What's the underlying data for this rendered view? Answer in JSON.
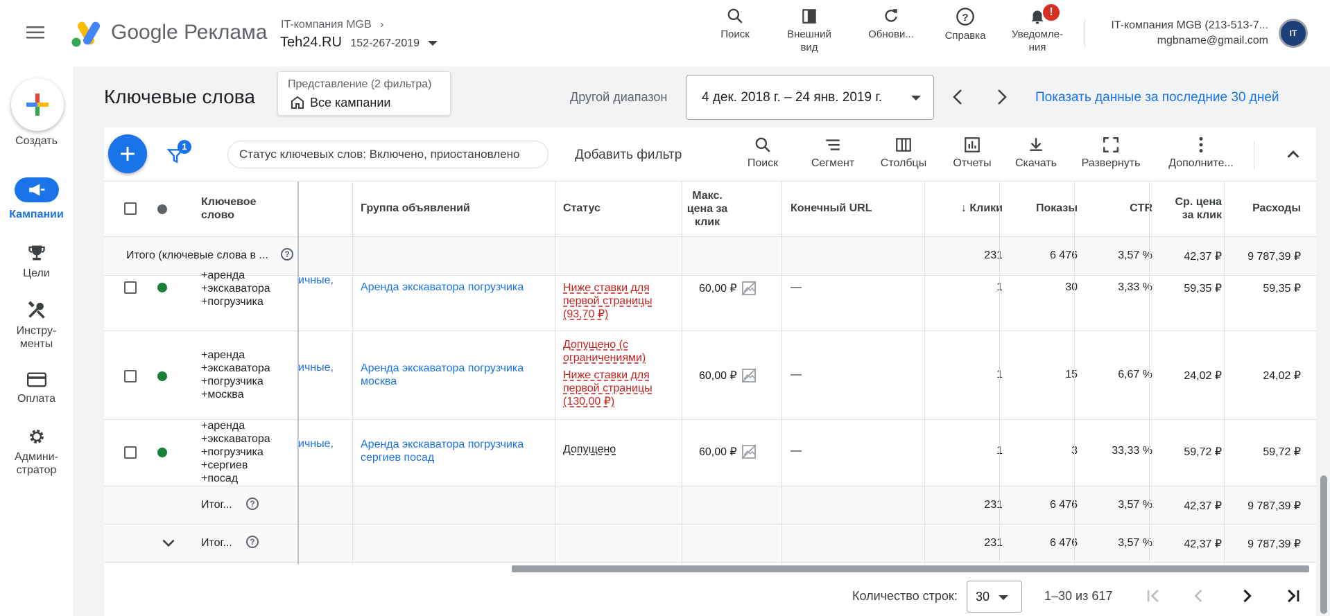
{
  "header": {
    "brand": "Google Реклама",
    "breadcrumb_parent": "IT-компания MGB",
    "account_name": "Teh24.RU",
    "account_id": "152-267-2019",
    "actions": [
      {
        "label": "Поиск",
        "icon": "search-icon"
      },
      {
        "label": "Внешний вид",
        "icon": "appearance-icon"
      },
      {
        "label": "Обнови...",
        "icon": "refresh-icon"
      },
      {
        "label": "Справка",
        "icon": "help-icon"
      },
      {
        "label": "Уведомле-ния",
        "icon": "bell-icon"
      }
    ],
    "notification_badge": "!",
    "user_account": "IT-компания MGB (213-513-7...",
    "user_email": "mgbname@gmail.com"
  },
  "sidebar": {
    "create_label": "Создать",
    "items": [
      {
        "label": "Кампании",
        "icon": "megaphone-icon",
        "active": true
      },
      {
        "label": "Цели",
        "icon": "trophy-icon"
      },
      {
        "label": "Инстру-менты",
        "icon": "tools-icon"
      },
      {
        "label": "Оплата",
        "icon": "credit-card-icon"
      },
      {
        "label": "Админи-стратор",
        "icon": "gear-icon"
      }
    ]
  },
  "page": {
    "title": "Ключевые слова",
    "view_label": "Представление (2 фильтра)",
    "view_value": "Все кампании",
    "date_range_label": "Другой диапазон",
    "date_range": "4 дек. 2018 г. – 24 янв. 2019 г.",
    "last30_link": "Показать данные за последние 30 дней"
  },
  "toolbar": {
    "filter_count": "1",
    "filter_chip": "Статус ключевых слов: Включено, приостановлено",
    "add_filter": "Добавить фильтр",
    "actions": [
      {
        "label": "Поиск",
        "icon": "search-icon"
      },
      {
        "label": "Сегмент",
        "icon": "segment-icon"
      },
      {
        "label": "Столбцы",
        "icon": "columns-icon"
      },
      {
        "label": "Отчеты",
        "icon": "reports-icon"
      },
      {
        "label": "Скачать",
        "icon": "download-icon"
      },
      {
        "label": "Развернуть",
        "icon": "fullscreen-icon"
      },
      {
        "label": "Дополните...",
        "icon": "more-icon"
      }
    ]
  },
  "table": {
    "headers": {
      "keyword": "Ключевое слово",
      "ad_group": "Группа объявлений",
      "status": "Статус",
      "max_cpc": "Макс. цена за клик",
      "final_url": "Конечный URL",
      "clicks": "Клики",
      "impressions": "Показы",
      "ctr": "CTR",
      "avg_cpc": "Ср. цена за клик",
      "cost": "Расходы"
    },
    "total_top": {
      "label": "Итого (ключевые слова в ...",
      "clicks": "231",
      "impressions": "6 476",
      "ctr": "3,57 %",
      "avg_cpc": "42,37 ₽",
      "cost": "9 787,39 ₽"
    },
    "rows": [
      {
        "keyword": "+аренда +экскаватора +погрузчика",
        "campaign": "ичные,",
        "ad_group": "Аренда экскаватора погрузчика",
        "status_lines": [
          "Ниже ставки для первой страницы (93,70 ₽)"
        ],
        "max_cpc": "60,00 ₽",
        "final_url": "—",
        "clicks": "1",
        "impressions": "30",
        "ctr": "3,33 %",
        "avg_cpc": "59,35 ₽",
        "cost": "59,35 ₽"
      },
      {
        "keyword": "+аренда +экскаватора +погрузчика +москва",
        "campaign": "ичные,",
        "ad_group": "Аренда экскаватора погрузчика москва",
        "status_lines": [
          "Допущено (с ограничениями)",
          "Ниже ставки для первой страницы (130,00 ₽)"
        ],
        "max_cpc": "60,00 ₽",
        "final_url": "—",
        "clicks": "1",
        "impressions": "15",
        "ctr": "6,67 %",
        "avg_cpc": "24,02 ₽",
        "cost": "24,02 ₽"
      },
      {
        "keyword": "+аренда +экскаватора +погрузчика +сергиев +посад",
        "campaign": "ичные,",
        "ad_group": "Аренда экскаватора погрузчика сергиев посад",
        "status_lines": [
          "Допущено"
        ],
        "max_cpc": "60,00 ₽",
        "final_url": "—",
        "clicks": "1",
        "impressions": "3",
        "ctr": "33,33 %",
        "avg_cpc": "59,72 ₽",
        "cost": "59,72 ₽"
      }
    ],
    "total_1": {
      "label": "Итог...",
      "clicks": "231",
      "impressions": "6 476",
      "ctr": "3,57 %",
      "avg_cpc": "42,37 ₽",
      "cost": "9 787,39 ₽"
    },
    "total_2": {
      "label": "Итог...",
      "clicks": "231",
      "impressions": "6 476",
      "ctr": "3,57 %",
      "avg_cpc": "42,37 ₽",
      "cost": "9 787,39 ₽"
    }
  },
  "pagination": {
    "rows_label": "Количество строк:",
    "rows_value": "30",
    "range": "1–30 из 617"
  },
  "colors": {
    "accent": "#1a73e8",
    "status_red": "#c5221f",
    "dot_green": "#188038"
  }
}
